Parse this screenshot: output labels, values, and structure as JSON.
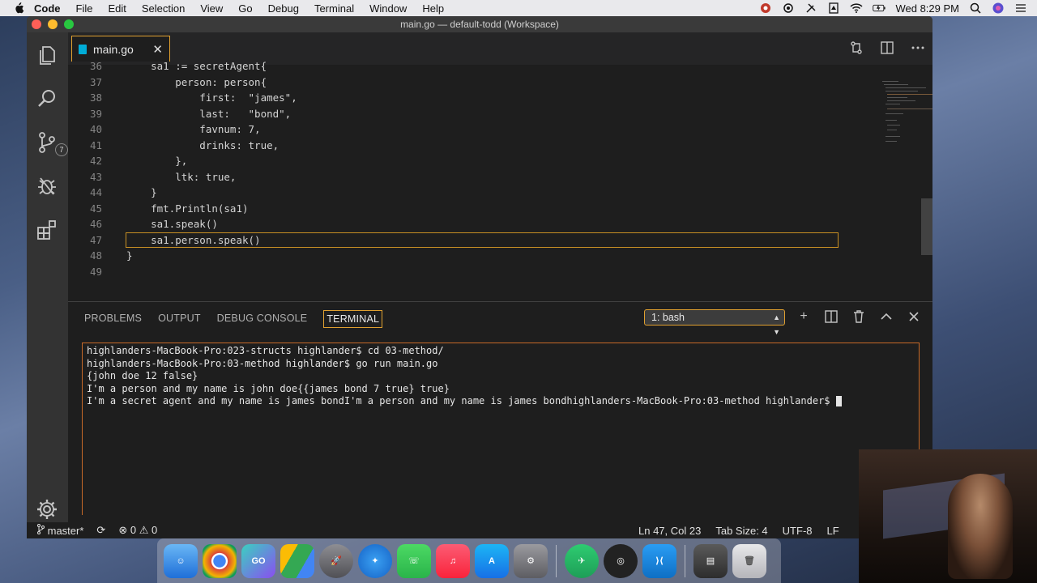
{
  "menubar": {
    "app_name": "Code",
    "items": [
      "File",
      "Edit",
      "Selection",
      "View",
      "Go",
      "Debug",
      "Terminal",
      "Window",
      "Help"
    ],
    "clock": "Wed 8:29 PM"
  },
  "window": {
    "title": "main.go — default-todd (Workspace)"
  },
  "tab": {
    "label": "main.go"
  },
  "activity": {
    "scm_badge": "7"
  },
  "editor": {
    "lines": [
      {
        "n": "36",
        "text": "    sa1 := secretAgent{"
      },
      {
        "n": "37",
        "text": "        person: person{"
      },
      {
        "n": "38",
        "text": "            first:  \"james\","
      },
      {
        "n": "39",
        "text": "            last:   \"bond\","
      },
      {
        "n": "40",
        "text": "            favnum: 7,"
      },
      {
        "n": "41",
        "text": "            drinks: true,"
      },
      {
        "n": "42",
        "text": "        },"
      },
      {
        "n": "43",
        "text": "        ltk: true,"
      },
      {
        "n": "44",
        "text": "    }"
      },
      {
        "n": "45",
        "text": "    fmt.Println(sa1)"
      },
      {
        "n": "46",
        "text": "    sa1.speak()"
      },
      {
        "n": "47",
        "text": "    sa1.person.speak()"
      },
      {
        "n": "48",
        "text": "}"
      },
      {
        "n": "49",
        "text": ""
      }
    ]
  },
  "panel": {
    "tabs": [
      "PROBLEMS",
      "OUTPUT",
      "DEBUG CONSOLE",
      "TERMINAL"
    ],
    "active_tab": "TERMINAL",
    "terminal_select": "1: bash"
  },
  "terminal": {
    "lines": [
      "highlanders-MacBook-Pro:023-structs highlander$ cd 03-method/",
      "highlanders-MacBook-Pro:03-method highlander$ go run main.go",
      "{john doe 12 false}",
      "I'm a person and my name is john doe{{james bond 7 true} true}",
      "I'm a secret agent and my name is james bondI'm a person and my name is james bondhighlanders-MacBook-Pro:03-method highlander$ "
    ]
  },
  "statusbar": {
    "branch": "master*",
    "errors": "0",
    "warnings": "0",
    "position": "Ln 47, Col 23",
    "tab_size": "Tab Size: 4",
    "encoding": "UTF-8",
    "eol": "LF"
  },
  "dock": {
    "apps": [
      "finder-icon",
      "chrome-icon",
      "goland-icon",
      "drive-icon",
      "launchpad-icon",
      "safari-icon",
      "facetime-icon",
      "music-icon",
      "appstore-icon",
      "preferences-icon",
      "testflight-icon",
      "obs-icon",
      "vscode-icon",
      "photos-icon",
      "trash-icon"
    ]
  },
  "colors": {
    "accent_border": "#e0a030",
    "terminal_border": "#c86a28",
    "editor_bg": "#1e1e1e",
    "activity_bg": "#333333"
  }
}
